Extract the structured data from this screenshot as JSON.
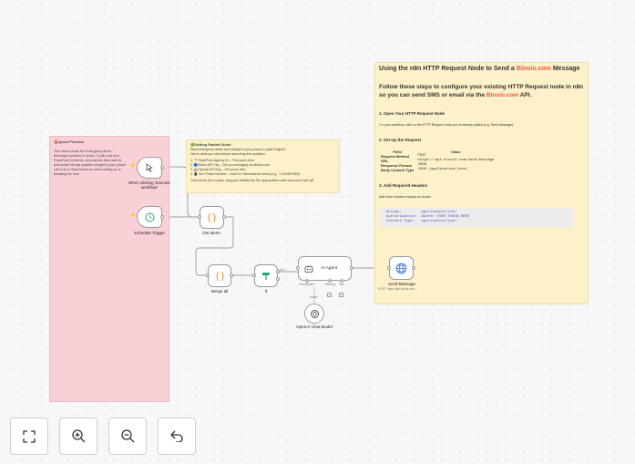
{
  "notes": {
    "quick_preview_title": "🚨Quick Preview:",
    "quick_preview_body": "This visual shows the Emergency Alerts → iMessage workflow in action. It pulls real-time PulsePoint incidents, summarizes them with AI, and sends friendly updates straight to your phone. Use it as a visual reference when setting up or tweaking the flow.",
    "getting_started_title": "🟢Getting Started Guide:",
    "getting_started_lines": [
      "Want emergency alerts sent straight to your phone in plain English?",
      "Here's what you need before launching this workflow:",
      "1. 📍PulsePoint Agency ID – Find yours here",
      "2. 🔵Blooio API Key – Set up messaging via Blooio.com",
      "3. 🤖OpenAI API Key – Get yours here",
      "4. 📱Your Phone Number – Add it in international format (e.g., +1234567890)",
      "Once these are in place, plug your details into the appropriate nodes and you're live! 🚀"
    ]
  },
  "doc": {
    "title_pre": "Using the n8n HTTP Request Node to Send a ",
    "title_brand": "Blooio.com",
    "title_post": " Message",
    "subtitle_pre": "Follow these steps to configure your existing HTTP Request node in n8n so you can send SMS or email via the ",
    "subtitle_brand": "Blooio.com",
    "subtitle_post": " API.",
    "step1_title": "1. Open Your HTTP Request Node",
    "step1_body": "• In your workflow, click on the HTTP Request node you've already added (e.g. Send Message).",
    "step2_title": "2. Set Up the Request",
    "table_headers": [
      "Field",
      "Value"
    ],
    "table_rows": [
      {
        "field": "Request Method",
        "value": "POST"
      },
      {
        "field": "URL",
        "value": "https://api.blooio.com/send-message"
      },
      {
        "field": "Response Format",
        "value": "JSON"
      },
      {
        "field": "Body Content Type",
        "value": "JSON (application/json)"
      }
    ],
    "step3_title": "3. Add Required Headers",
    "step3_body": "Add three headers exactly as shown:",
    "code": "Accept:         application/json\nAuthorization:  Bearer YOUR_TOKEN_HERE\nContent-Type:   application/json"
  },
  "nodes": {
    "manual_trigger": "When clicking 'Execute workflow'",
    "schedule_trigger": "Schedule Trigger",
    "get_alerts": "Get alerts",
    "merge_all": "Merge all",
    "if_node": "If",
    "ai_agent": "AI Agent",
    "ai_agent_ports": [
      "Chat Model*",
      "Memory",
      "Tool"
    ],
    "if_true_label": "true",
    "openai_model": "OpenAI Chat Model",
    "openai_port": "Model",
    "send_message": "Send Message",
    "send_message_sub": "POST: https://api.blooio.com..."
  },
  "toolbar": {
    "fit_view": "fit-view-icon",
    "zoom_in": "zoom-in-icon",
    "zoom_out": "zoom-out-icon",
    "undo": "undo-icon"
  },
  "colors": {
    "accent": "#ef5a4b",
    "note_red": "#f8d1d6",
    "note_yellow": "#fdf1c9",
    "schedule_green": "#2fa77a",
    "code_orange": "#f08a24",
    "if_green": "#27a36f",
    "globe_blue": "#3b6fd8"
  }
}
